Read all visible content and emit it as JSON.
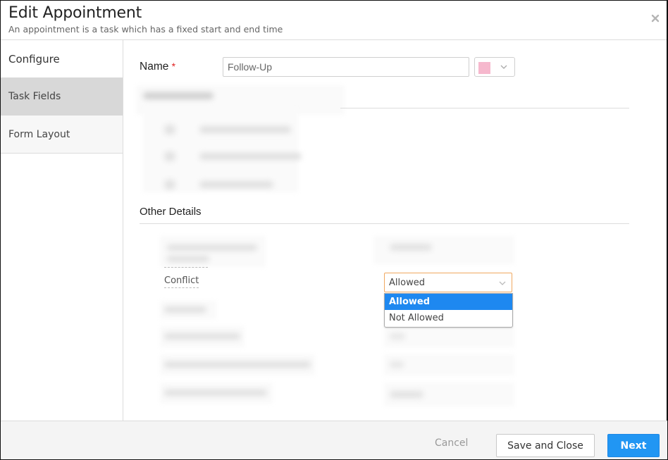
{
  "header": {
    "title": "Edit Appointment",
    "subtitle": "An appointment is a task which has a fixed start and end time",
    "close_icon": "close-x-icon"
  },
  "sidebar": {
    "items": [
      {
        "label": "Configure",
        "state": "default"
      },
      {
        "label": "Task Fields",
        "state": "selected"
      },
      {
        "label": "Form Layout",
        "state": "default"
      }
    ]
  },
  "form": {
    "name_label": "Name",
    "required_marker": "*",
    "name_value": "Follow-Up",
    "color_swatch": "#f6b8cd",
    "color_picker_icon": "chevron-down-icon",
    "sections": {
      "other_details_title": "Other Details"
    },
    "conflict": {
      "label": "Conflict",
      "selected": "Allowed",
      "options": [
        "Allowed",
        "Not Allowed"
      ],
      "highlighted_option": "Allowed"
    }
  },
  "footer": {
    "cancel_label": "Cancel",
    "save_close_label": "Save and Close",
    "next_label": "Next"
  },
  "colors": {
    "accent": "#2196f3",
    "dropdown_highlight": "#1e88f0",
    "focus_border": "#f0a860",
    "required": "#e02020"
  }
}
